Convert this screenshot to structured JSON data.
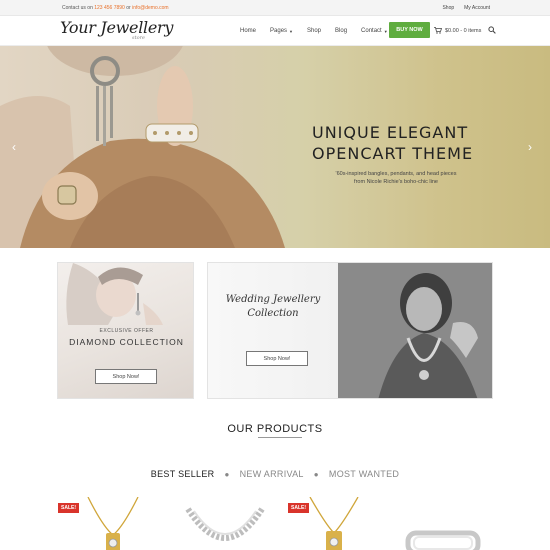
{
  "topbar": {
    "contact_prefix": "Contact us on",
    "phone": "123 456 7890",
    "or_text": "or",
    "email": "info@demo.com",
    "links": [
      "Shop",
      "My Account"
    ]
  },
  "header": {
    "logo_text": "Your Jewellery",
    "logo_sub": "store",
    "nav": [
      {
        "label": "Home",
        "dropdown": false
      },
      {
        "label": "Pages",
        "dropdown": true
      },
      {
        "label": "Shop",
        "dropdown": false
      },
      {
        "label": "Blog",
        "dropdown": false
      },
      {
        "label": "Contact",
        "dropdown": true
      }
    ],
    "buy_now": "BUY NOW",
    "cart_text": "$0.00 - 0 items",
    "colors": {
      "buy": "#5fad3f",
      "accent": "#e8702a"
    }
  },
  "hero": {
    "title_line1": "UNIQUE ELEGANT",
    "title_line2": "OPENCART THEME",
    "caption_line1": "'60s-inspired bangles, pendants, and head pieces",
    "caption_line2": "from Nicole Richie's boho-chic line"
  },
  "banners": [
    {
      "kicker": "EXCLUSIVE OFFER",
      "heading": "DIAMOND COLLECTION",
      "button": "Shop Now!"
    },
    {
      "script_line1": "Wedding Jewellery",
      "script_line2": "Collection",
      "button": "Shop Now!"
    }
  ],
  "products": {
    "title": "OUR PRODUCTS",
    "tabs": [
      "BEST SELLER",
      "NEW ARRIVAL",
      "MOST WANTED"
    ],
    "active_tab": "BEST SELLER",
    "items": [
      {
        "sale_badge": "SALE!",
        "icon": "pendant-icon"
      },
      {
        "icon": "necklace-icon"
      },
      {
        "sale_badge": "SALE!",
        "icon": "pendant-icon"
      },
      {
        "icon": "bracelet-icon"
      }
    ],
    "sale_color": "#d9342b"
  }
}
